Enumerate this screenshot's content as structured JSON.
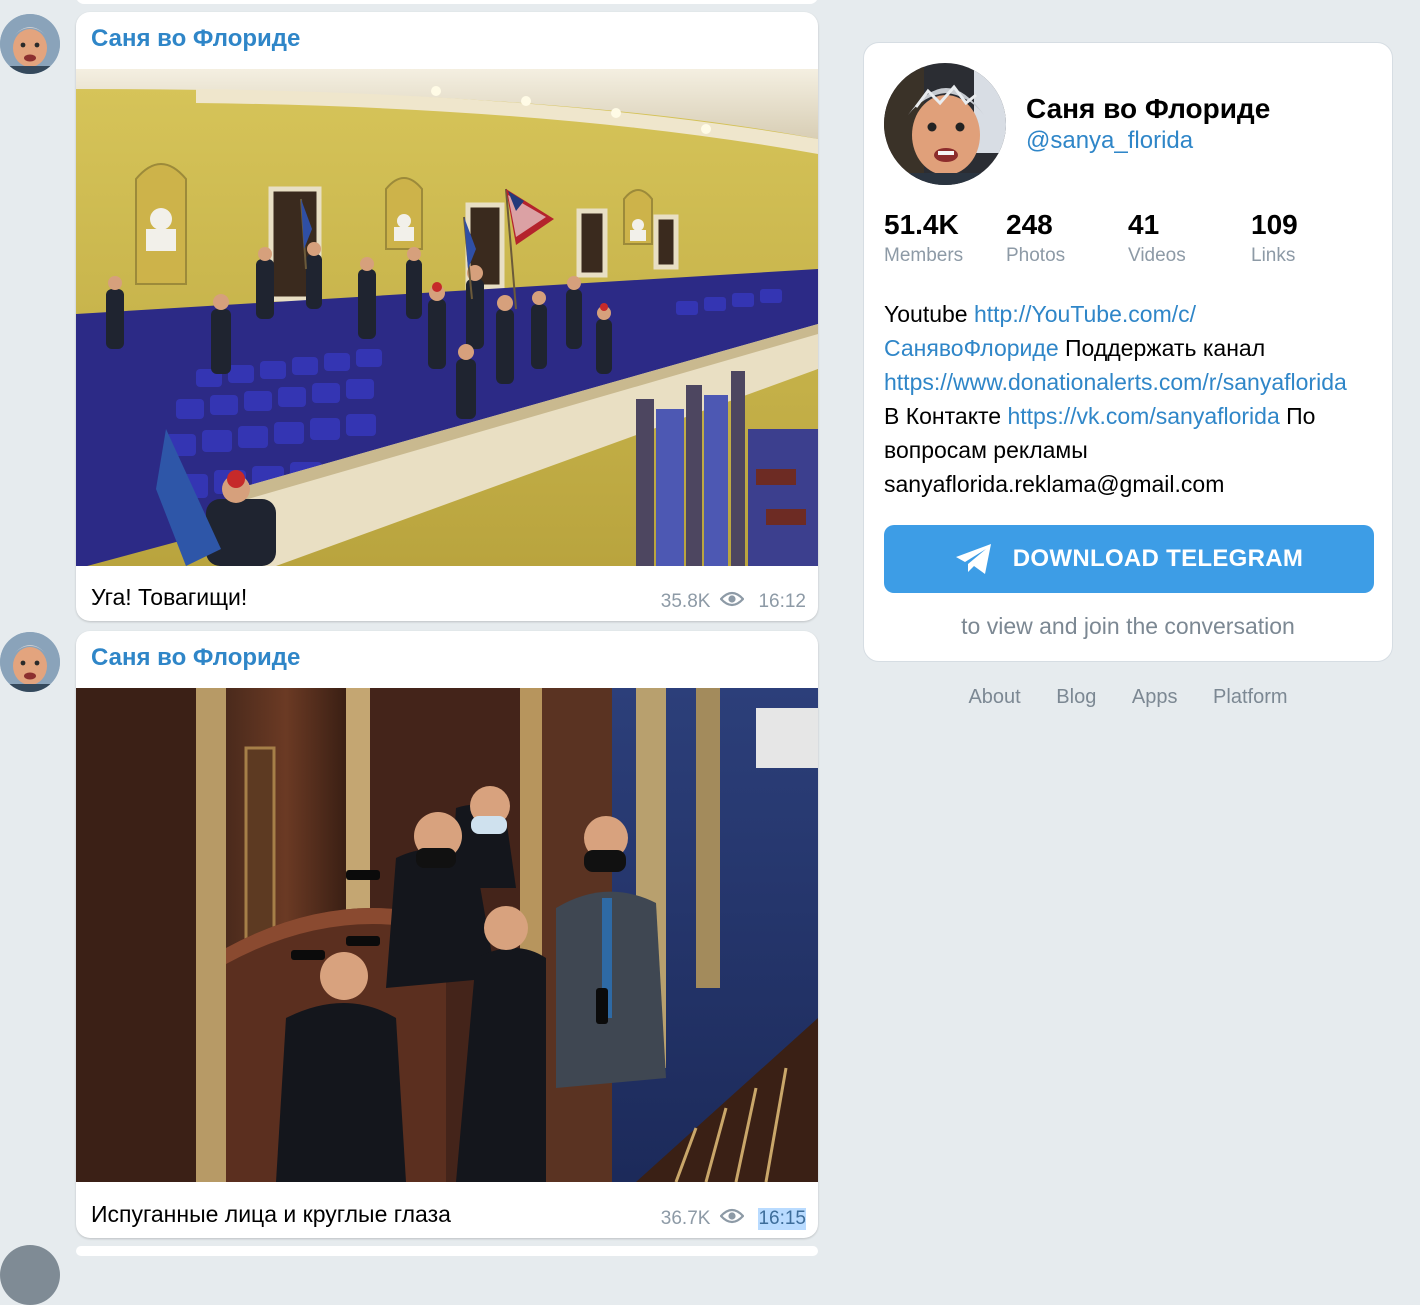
{
  "channel": {
    "name": "Саня во Флориде",
    "handle": "@sanya_florida",
    "stats": [
      {
        "value": "51.4K",
        "label": "Members"
      },
      {
        "value": "248",
        "label": "Photos"
      },
      {
        "value": "41",
        "label": "Videos"
      },
      {
        "value": "109",
        "label": "Links"
      }
    ],
    "description": {
      "t1": "Youtube ",
      "link1": "http://YouTube.com/c/",
      "link1b": "СанявоФлориде",
      "t2": " Поддержать канал ",
      "link2": "https://www.donationalerts.com/r/sanyaflorida",
      "t3": "В Контакте ",
      "link3": "https://vk.com/sanyaflorida",
      "t4": " По вопросам рекламы ",
      "email": "sanyaflorida.reklama@gmail.com"
    },
    "download_button": "DOWNLOAD TELEGRAM",
    "subtitle": "to view and join the conversation"
  },
  "messages": [
    {
      "author": "Саня во Флориде",
      "text": "Уга! Товагищи!",
      "views": "35.8K",
      "time": "16:12"
    },
    {
      "author": "Саня во Флориде",
      "text": "Испуганные лица и круглые глаза",
      "views": "36.7K",
      "time": "16:15"
    }
  ],
  "footer": {
    "links": [
      "About",
      "Blog",
      "Apps",
      "Platform"
    ]
  },
  "colors": {
    "accent": "#2f86c8",
    "button": "#3d9de6",
    "background": "#e6ebee",
    "muted": "#8d9aa6",
    "selection": "#b9dbff"
  }
}
